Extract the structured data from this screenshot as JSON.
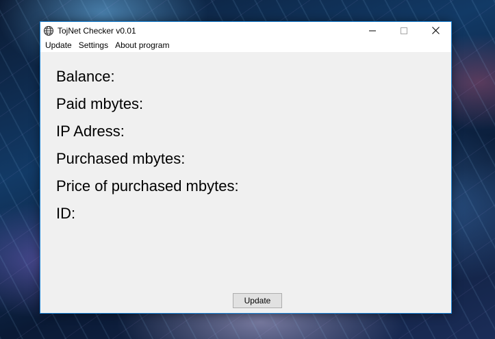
{
  "window": {
    "title": "TojNet Checker v0.01",
    "icon": "globe-icon",
    "controls": [
      "minimize-icon",
      "maximize-icon",
      "close-icon"
    ]
  },
  "menu": {
    "items": [
      {
        "label": "Update"
      },
      {
        "label": "Settings"
      },
      {
        "label": "About program"
      }
    ]
  },
  "info": {
    "balance_label": "Balance:",
    "paid_mbytes_label": "Paid mbytes:",
    "ip_address_label": "IP Adress:",
    "purchased_mbytes_label": "Purchased mbytes:",
    "price_label": "Price of purchased mbytes:",
    "id_label": "ID:"
  },
  "footer": {
    "update_button_label": "Update"
  },
  "colors": {
    "window_border": "#1883d7",
    "window_bg": "#f0f0f0",
    "button_bg": "#e1e1e1",
    "button_border": "#adadad"
  }
}
